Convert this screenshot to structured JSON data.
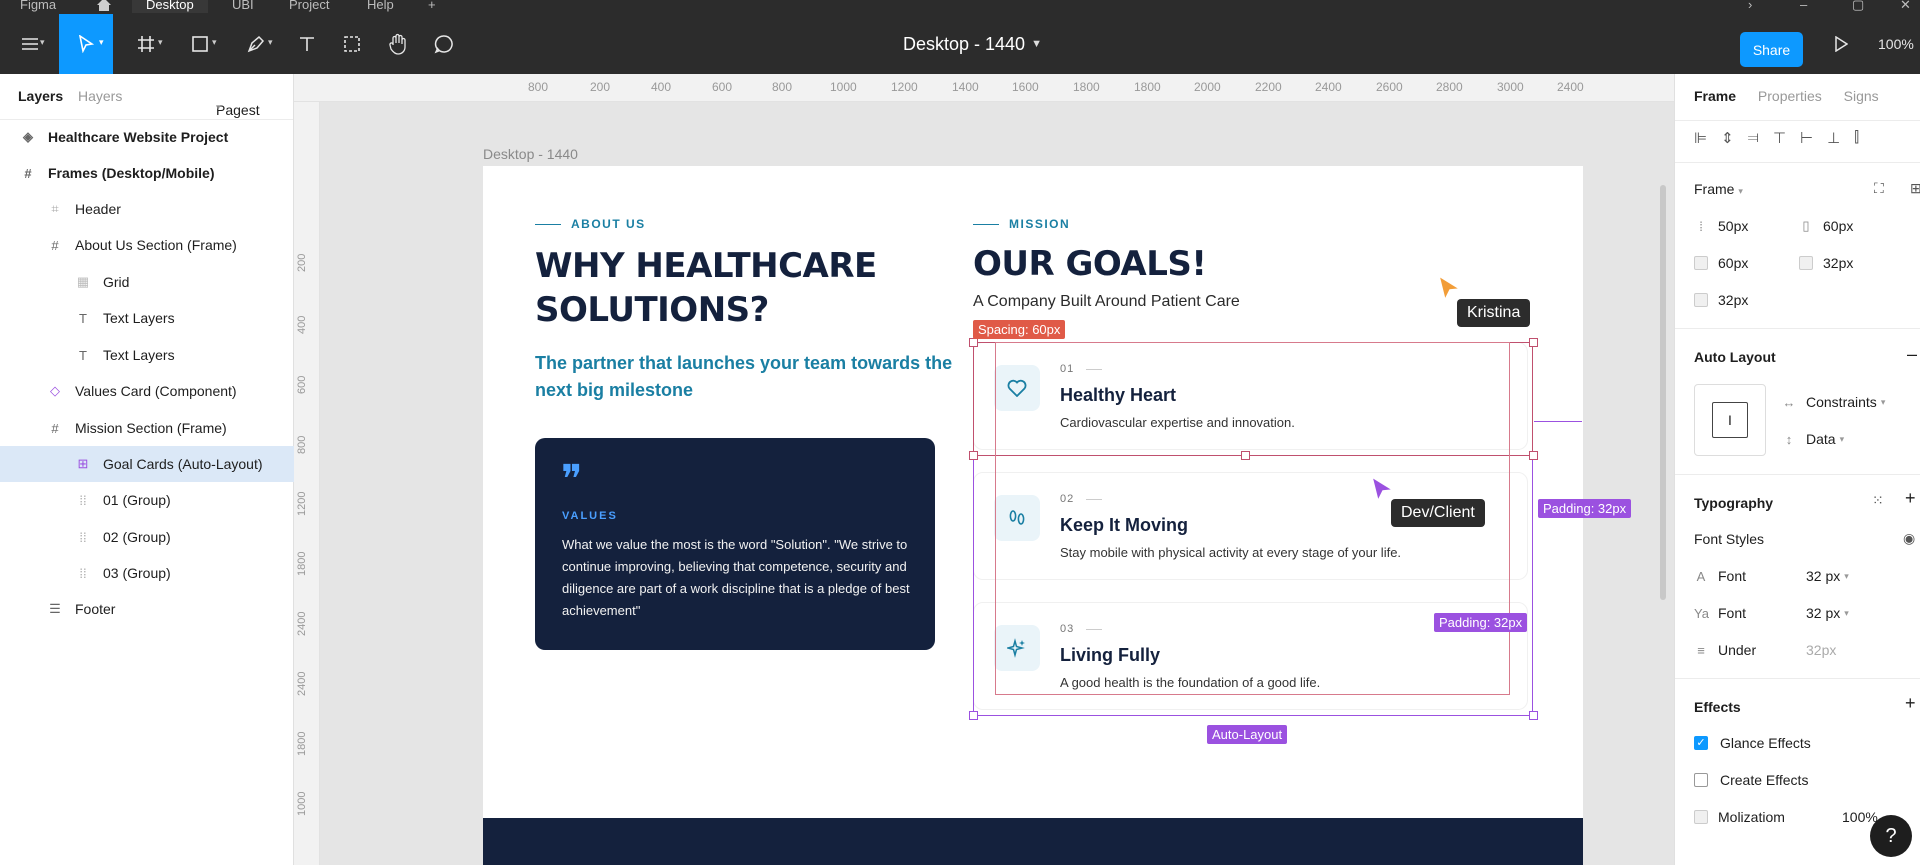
{
  "titlebar": {
    "app": "Figma",
    "tabs": [
      "Desktop",
      "UBI",
      "Project",
      "Help"
    ],
    "new_tab": "+"
  },
  "toolbar": {
    "file_title": "Desktop - 1440",
    "share_label": "Share",
    "zoom": "100%"
  },
  "left_panel": {
    "tabs": [
      "Layers",
      "Hayers"
    ],
    "page_selector": "Pagest",
    "layers": [
      {
        "label": "Healthcare Website Project",
        "icon": "component-stack-icon"
      },
      {
        "label": "Frames (Desktop/Mobile)",
        "icon": "frame-icon"
      },
      {
        "label": "Header",
        "icon": "frame-small-icon"
      },
      {
        "label": "About Us Section (Frame)",
        "icon": "frame-icon"
      },
      {
        "label": "Grid",
        "icon": "grid-icon"
      },
      {
        "label": "Text Layers",
        "icon": "text-icon"
      },
      {
        "label": "Text Layers",
        "icon": "text-icon"
      },
      {
        "label": "Values Card (Component)",
        "icon": "component-icon"
      },
      {
        "label": "Mission Section (Frame)",
        "icon": "frame-icon"
      },
      {
        "label": "Goal Cards (Auto-Layout)",
        "icon": "auto-layout-icon"
      },
      {
        "label": "01 (Group)",
        "icon": "group-icon"
      },
      {
        "label": "02 (Group)",
        "icon": "group-icon"
      },
      {
        "label": "03 (Group)",
        "icon": "group-icon"
      },
      {
        "label": "Footer",
        "icon": "list-icon"
      }
    ]
  },
  "rulers": {
    "top": [
      "800",
      "200",
      "400",
      "600",
      "800",
      "1000",
      "1200",
      "1400",
      "1600",
      "1800",
      "1800",
      "2000",
      "2200",
      "2400",
      "2600",
      "2800",
      "3000",
      "2400"
    ],
    "left": [
      "200",
      "400",
      "600",
      "800",
      "1200",
      "1800",
      "2400",
      "2400",
      "1800",
      "1000"
    ]
  },
  "canvas": {
    "frame_label": "Desktop - 1440",
    "about": {
      "eyebrow": "ABOUT US",
      "heading_line1": "WHY HEALTHCARE",
      "heading_line2": "SOLUTIONS?",
      "lead_line1": "The partner that launches your team towards the",
      "lead_line2": "next big milestone",
      "values_label": "VALUES",
      "values_text": "What we value the most is the word \"Solution\". \"We strive to continue improving, believing that competence, security and diligence are part of a work discipline that is a pledge of best achievement\""
    },
    "mission": {
      "eyebrow": "MISSION",
      "heading": "OUR GOALS!",
      "subtitle": "A Company Built Around Patient Care",
      "goals": [
        {
          "num": "01",
          "title": "Healthy Heart",
          "desc": "Cardiovascular expertise and innovation.",
          "icon": "heart-icon"
        },
        {
          "num": "02",
          "title": "Keep It Moving",
          "desc": "Stay mobile with physical activity at every stage of your life.",
          "icon": "footprints-icon"
        },
        {
          "num": "03",
          "title": "Living Fully",
          "desc": "A good health is the foundation of a good life.",
          "icon": "sparkle-icon"
        }
      ]
    },
    "overlays": {
      "spacing_tag": "Spacing: 60px",
      "padding_tag_right": "Padding: 32px",
      "padding_tag_inner": "Padding: 32px",
      "auto_layout_tag": "Auto-Layout",
      "cursor_kristina": "Kristina",
      "cursor_dev": "Dev/Client"
    },
    "colors": {
      "navy": "#14213d",
      "teal": "#1a7fa3",
      "selection_red": "#c0506e",
      "selection_purple": "#9b51e0",
      "figma_blue": "#0d99ff"
    }
  },
  "right_panel": {
    "tabs": [
      "Frame",
      "Properties",
      "Signs"
    ],
    "frame_section": "Frame",
    "frame_fields": [
      "50px",
      "60px",
      "60px",
      "32px",
      "32px"
    ],
    "auto_layout_section": "Auto Layout",
    "constraints_label": "Constraints",
    "data_label": "Data",
    "typography_section": "Typography",
    "font_styles_label": "Font Styles",
    "font_rows": [
      {
        "icon": "A",
        "label": "Font",
        "value": "32 px"
      },
      {
        "icon": "Ya",
        "label": "Font",
        "value": "32 px"
      },
      {
        "icon": "≡",
        "label": "Under",
        "value": "32px"
      }
    ],
    "effects_section": "Effects",
    "effects": [
      {
        "label": "Glance Effects",
        "checked": true
      },
      {
        "label": "Create Effects",
        "checked": false
      },
      {
        "label": "Molizatiom",
        "value": "100%"
      }
    ],
    "help": "?"
  }
}
